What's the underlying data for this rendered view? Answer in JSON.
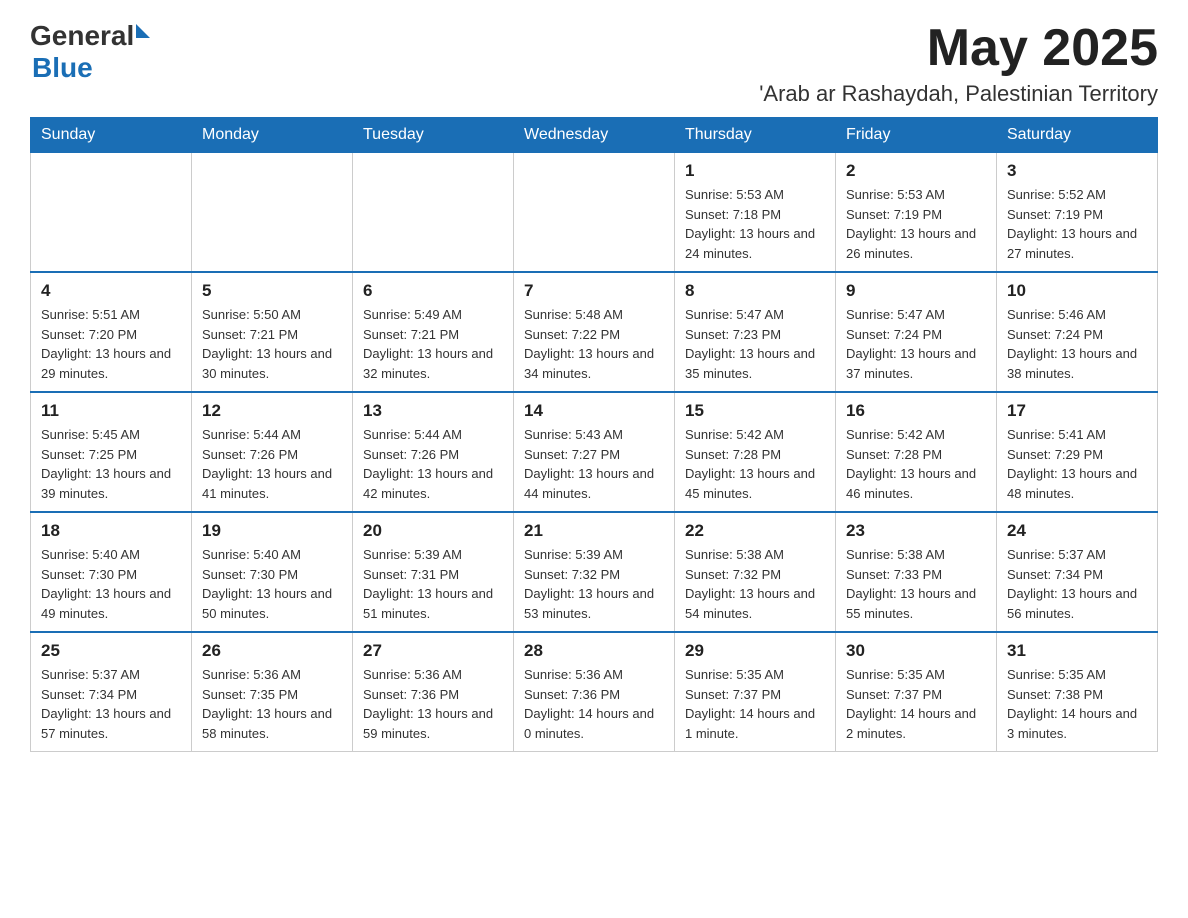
{
  "header": {
    "logo_general": "General",
    "logo_blue": "Blue",
    "month_title": "May 2025",
    "location": "'Arab ar Rashaydah, Palestinian Territory"
  },
  "weekdays": [
    "Sunday",
    "Monday",
    "Tuesday",
    "Wednesday",
    "Thursday",
    "Friday",
    "Saturday"
  ],
  "weeks": [
    [
      {
        "day": "",
        "info": ""
      },
      {
        "day": "",
        "info": ""
      },
      {
        "day": "",
        "info": ""
      },
      {
        "day": "",
        "info": ""
      },
      {
        "day": "1",
        "info": "Sunrise: 5:53 AM\nSunset: 7:18 PM\nDaylight: 13 hours and 24 minutes."
      },
      {
        "day": "2",
        "info": "Sunrise: 5:53 AM\nSunset: 7:19 PM\nDaylight: 13 hours and 26 minutes."
      },
      {
        "day": "3",
        "info": "Sunrise: 5:52 AM\nSunset: 7:19 PM\nDaylight: 13 hours and 27 minutes."
      }
    ],
    [
      {
        "day": "4",
        "info": "Sunrise: 5:51 AM\nSunset: 7:20 PM\nDaylight: 13 hours and 29 minutes."
      },
      {
        "day": "5",
        "info": "Sunrise: 5:50 AM\nSunset: 7:21 PM\nDaylight: 13 hours and 30 minutes."
      },
      {
        "day": "6",
        "info": "Sunrise: 5:49 AM\nSunset: 7:21 PM\nDaylight: 13 hours and 32 minutes."
      },
      {
        "day": "7",
        "info": "Sunrise: 5:48 AM\nSunset: 7:22 PM\nDaylight: 13 hours and 34 minutes."
      },
      {
        "day": "8",
        "info": "Sunrise: 5:47 AM\nSunset: 7:23 PM\nDaylight: 13 hours and 35 minutes."
      },
      {
        "day": "9",
        "info": "Sunrise: 5:47 AM\nSunset: 7:24 PM\nDaylight: 13 hours and 37 minutes."
      },
      {
        "day": "10",
        "info": "Sunrise: 5:46 AM\nSunset: 7:24 PM\nDaylight: 13 hours and 38 minutes."
      }
    ],
    [
      {
        "day": "11",
        "info": "Sunrise: 5:45 AM\nSunset: 7:25 PM\nDaylight: 13 hours and 39 minutes."
      },
      {
        "day": "12",
        "info": "Sunrise: 5:44 AM\nSunset: 7:26 PM\nDaylight: 13 hours and 41 minutes."
      },
      {
        "day": "13",
        "info": "Sunrise: 5:44 AM\nSunset: 7:26 PM\nDaylight: 13 hours and 42 minutes."
      },
      {
        "day": "14",
        "info": "Sunrise: 5:43 AM\nSunset: 7:27 PM\nDaylight: 13 hours and 44 minutes."
      },
      {
        "day": "15",
        "info": "Sunrise: 5:42 AM\nSunset: 7:28 PM\nDaylight: 13 hours and 45 minutes."
      },
      {
        "day": "16",
        "info": "Sunrise: 5:42 AM\nSunset: 7:28 PM\nDaylight: 13 hours and 46 minutes."
      },
      {
        "day": "17",
        "info": "Sunrise: 5:41 AM\nSunset: 7:29 PM\nDaylight: 13 hours and 48 minutes."
      }
    ],
    [
      {
        "day": "18",
        "info": "Sunrise: 5:40 AM\nSunset: 7:30 PM\nDaylight: 13 hours and 49 minutes."
      },
      {
        "day": "19",
        "info": "Sunrise: 5:40 AM\nSunset: 7:30 PM\nDaylight: 13 hours and 50 minutes."
      },
      {
        "day": "20",
        "info": "Sunrise: 5:39 AM\nSunset: 7:31 PM\nDaylight: 13 hours and 51 minutes."
      },
      {
        "day": "21",
        "info": "Sunrise: 5:39 AM\nSunset: 7:32 PM\nDaylight: 13 hours and 53 minutes."
      },
      {
        "day": "22",
        "info": "Sunrise: 5:38 AM\nSunset: 7:32 PM\nDaylight: 13 hours and 54 minutes."
      },
      {
        "day": "23",
        "info": "Sunrise: 5:38 AM\nSunset: 7:33 PM\nDaylight: 13 hours and 55 minutes."
      },
      {
        "day": "24",
        "info": "Sunrise: 5:37 AM\nSunset: 7:34 PM\nDaylight: 13 hours and 56 minutes."
      }
    ],
    [
      {
        "day": "25",
        "info": "Sunrise: 5:37 AM\nSunset: 7:34 PM\nDaylight: 13 hours and 57 minutes."
      },
      {
        "day": "26",
        "info": "Sunrise: 5:36 AM\nSunset: 7:35 PM\nDaylight: 13 hours and 58 minutes."
      },
      {
        "day": "27",
        "info": "Sunrise: 5:36 AM\nSunset: 7:36 PM\nDaylight: 13 hours and 59 minutes."
      },
      {
        "day": "28",
        "info": "Sunrise: 5:36 AM\nSunset: 7:36 PM\nDaylight: 14 hours and 0 minutes."
      },
      {
        "day": "29",
        "info": "Sunrise: 5:35 AM\nSunset: 7:37 PM\nDaylight: 14 hours and 1 minute."
      },
      {
        "day": "30",
        "info": "Sunrise: 5:35 AM\nSunset: 7:37 PM\nDaylight: 14 hours and 2 minutes."
      },
      {
        "day": "31",
        "info": "Sunrise: 5:35 AM\nSunset: 7:38 PM\nDaylight: 14 hours and 3 minutes."
      }
    ]
  ]
}
